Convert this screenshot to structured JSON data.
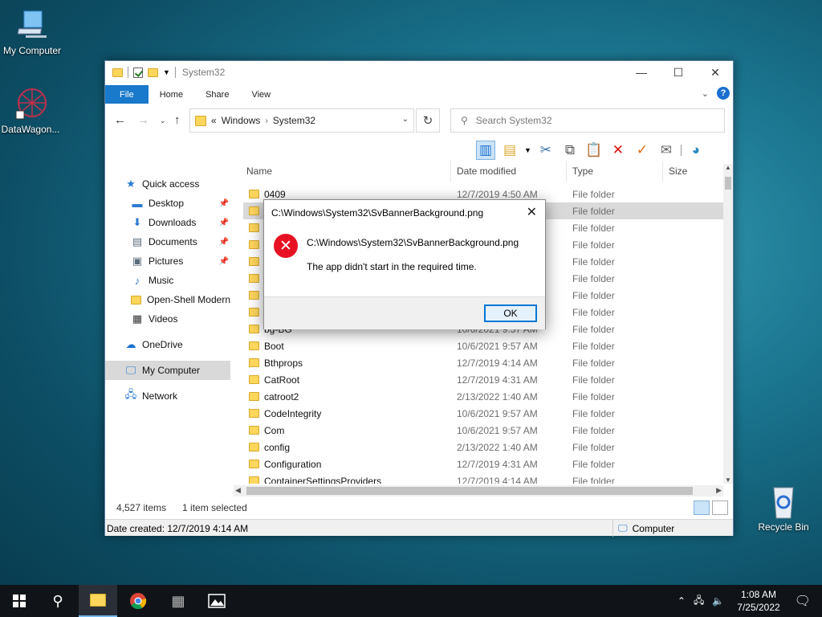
{
  "desktop": {
    "icons": [
      {
        "label": "My Computer",
        "icon": "computer-icon"
      },
      {
        "label": "DataWagon...",
        "icon": "network-globe-icon"
      },
      {
        "label": "Recycle Bin",
        "icon": "recycle-bin-icon"
      }
    ]
  },
  "window": {
    "title": "System32",
    "ribbon_tabs": [
      "File",
      "Home",
      "Share",
      "View"
    ],
    "address": {
      "prefix": "«",
      "crumbs": [
        "Windows",
        "System32"
      ]
    },
    "search_placeholder": "Search System32",
    "nav": {
      "items": [
        {
          "label": "Quick access",
          "icon": "star-icon"
        },
        {
          "label": "Desktop",
          "icon": "desktop-icon",
          "pinned": true
        },
        {
          "label": "Downloads",
          "icon": "download-icon",
          "pinned": true
        },
        {
          "label": "Documents",
          "icon": "documents-icon",
          "pinned": true
        },
        {
          "label": "Pictures",
          "icon": "pictures-icon",
          "pinned": true
        },
        {
          "label": "Music",
          "icon": "music-icon"
        },
        {
          "label": "Open-Shell Modern",
          "icon": "folder-icon"
        },
        {
          "label": "Videos",
          "icon": "videos-icon"
        },
        {
          "label": "OneDrive",
          "icon": "cloud-icon"
        },
        {
          "label": "My Computer",
          "icon": "computer-icon"
        },
        {
          "label": "Network",
          "icon": "network-icon"
        }
      ]
    },
    "columns": [
      "Name",
      "Date modified",
      "Type",
      "Size"
    ],
    "files": [
      {
        "name": "0409",
        "date": "12/7/2019 4:50 AM",
        "type": "File folder"
      },
      {
        "name": "",
        "date": "",
        "type": "File folder"
      },
      {
        "name": "",
        "date": "",
        "type": "File folder"
      },
      {
        "name": "",
        "date": "",
        "type": "File folder"
      },
      {
        "name": "",
        "date": "",
        "type": "File folder"
      },
      {
        "name": "",
        "date": "",
        "type": "File folder"
      },
      {
        "name": "",
        "date": "",
        "type": "File folder"
      },
      {
        "name": "",
        "date": "",
        "type": "File folder"
      },
      {
        "name": "bg-BG",
        "date": "10/6/2021 9:57 AM",
        "type": "File folder"
      },
      {
        "name": "Boot",
        "date": "10/6/2021 9:57 AM",
        "type": "File folder"
      },
      {
        "name": "Bthprops",
        "date": "12/7/2019 4:14 AM",
        "type": "File folder"
      },
      {
        "name": "CatRoot",
        "date": "12/7/2019 4:31 AM",
        "type": "File folder"
      },
      {
        "name": "catroot2",
        "date": "2/13/2022 1:40 AM",
        "type": "File folder"
      },
      {
        "name": "CodeIntegrity",
        "date": "10/6/2021 9:57 AM",
        "type": "File folder"
      },
      {
        "name": "Com",
        "date": "10/6/2021 9:57 AM",
        "type": "File folder"
      },
      {
        "name": "config",
        "date": "2/13/2022 1:40 AM",
        "type": "File folder"
      },
      {
        "name": "Configuration",
        "date": "12/7/2019 4:31 AM",
        "type": "File folder"
      },
      {
        "name": "ContainerSettingsProviders",
        "date": "12/7/2019 4:14 AM",
        "type": "File folder"
      }
    ],
    "status": {
      "count": "4,527 items",
      "selected": "1 item selected"
    },
    "details": {
      "created": "Date created: 12/7/2019 4:14 AM",
      "location": "Computer"
    }
  },
  "dialog": {
    "title": "C:\\Windows\\System32\\SvBannerBackground.png",
    "path": "C:\\Windows\\System32\\SvBannerBackground.png",
    "message": "The app didn't start in the required time.",
    "ok_label": "OK"
  },
  "taskbar": {
    "time": "1:08 AM",
    "date": "7/25/2022"
  }
}
